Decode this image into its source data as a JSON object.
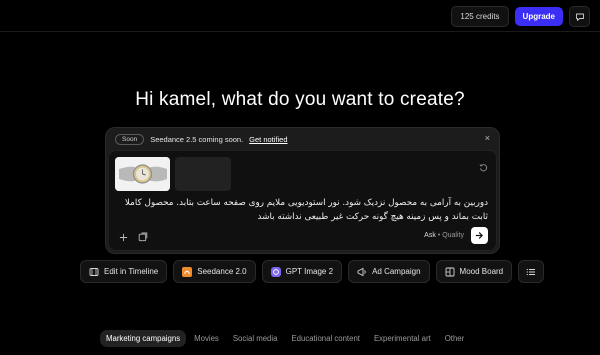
{
  "topbar": {
    "credits": "125 credits",
    "upgrade": "Upgrade",
    "icon": "chat-bubble-icon"
  },
  "headline": "Hi kamel, what do you want to create?",
  "composer": {
    "badge": "Soon",
    "notice_text": "Seedance 2.5 coming soon.",
    "notice_link": "Get notified",
    "close": "×",
    "prompt": "دوربین به آرامی به محصول نزدیک شود. نور استودیویی ملایم روی صفحه ساعت بتابد. محصول کاملا ثابت بماند و پس زمینه هیچ گونه حرکت غیر طبیعی نداشته باشد",
    "ask_label": "Ask",
    "dot": "•",
    "quality_label": "Quality",
    "tools": [
      "plus-icon",
      "attachment-icon"
    ]
  },
  "actions": [
    {
      "label": "Edit in Timeline",
      "icon": "film-icon",
      "color": "#d9d9d9"
    },
    {
      "label": "Seedance 2.0",
      "icon": "seedance-icon",
      "color": "#f08c2e"
    },
    {
      "label": "GPT Image 2",
      "icon": "gpt-icon",
      "color": "#7b68ee"
    },
    {
      "label": "Ad Campaign",
      "icon": "ad-icon",
      "color": "#d9d9d9"
    },
    {
      "label": "Mood Board",
      "icon": "board-icon",
      "color": "#d9d9d9"
    }
  ],
  "categories": [
    {
      "label": "Marketing campaigns",
      "active": true
    },
    {
      "label": "Movies"
    },
    {
      "label": "Social media"
    },
    {
      "label": "Educational content"
    },
    {
      "label": "Experimental art"
    },
    {
      "label": "Other"
    }
  ],
  "colors": {
    "accent": "#3b2ff5",
    "background": "#000000"
  }
}
